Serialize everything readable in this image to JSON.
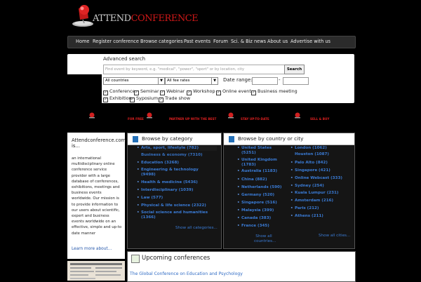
{
  "logo": {
    "part1": "ATTEND",
    "part2": "CONFERENCE"
  },
  "nav": [
    "Home",
    "Register conference",
    "Browse categories",
    "Past events",
    "Forum",
    "Sci. & Biz news",
    "About us",
    "Advertise with us"
  ],
  "search": {
    "title": "Advanced search",
    "placeholder": "Find event by keyword, e.g. \"medical\", \"power\", \"sport\" or by location, city",
    "button": "Search",
    "country_select": "All countries",
    "fee_select": "All fee rates",
    "date_label": "Date range:",
    "date_dash": "-",
    "types": [
      "Conference",
      "Seminar",
      "Webinar",
      "Workshop",
      "Online event",
      "Business meeting",
      "Exhibition",
      "Syposium",
      "Trade show"
    ]
  },
  "banner": [
    "FOR FREE",
    "PARTNER UP WITH THE BEST",
    "STAY UP-TO-DATE",
    "SELL & BUY"
  ],
  "about": {
    "title": "Attendconference.com is...",
    "body": "an international multidisciplinary online conference service provider with a large database of conferences, exhibitions, meetings and business events worldwide. Our mission is to provide information to our users about scientific, expert and business events worldwide on an effective, simple and up-to date manner",
    "more": "Learn more about..."
  },
  "categories": {
    "title": "Browse by category",
    "items": [
      "Arts, sport, lifestyle (782)",
      "Business & economy (7310)",
      "Education (3268)",
      "Engineering & technology (9498)",
      "Health & medicine (5436)",
      "Interdisciplinary (1039)",
      "Law (577)",
      "Physical & life science (2322)",
      "Social science and humanities (1366)"
    ],
    "show_all": "Show all categories..."
  },
  "countries": {
    "title": "Browse by country or city",
    "col1": [
      "United States (5251)",
      "United Kingdom (1783)",
      "Australia (1183)",
      "China (882)",
      "Netherlands (590)",
      "Germany (520)",
      "Singapore (516)",
      "Malaysia (399)",
      "Canada (383)",
      "France (345)"
    ],
    "col2": [
      "London (1062)",
      "Houston (1087)",
      "Palo Alto (842)",
      "Singapore (421)",
      "Online Webcast (333)",
      "Sydney (254)",
      "Kuala Lumpur (231)",
      "Amsterdam (216)",
      "Paris (212)",
      "Athens (211)"
    ],
    "show_all_countries": "Show all countries...",
    "show_all_cities": "Show all cities..."
  },
  "upcoming": {
    "title": "Upcoming conferences",
    "first_item": "The Global Conference on Education and Psychology"
  },
  "colors": {
    "accent_red": "#d01818",
    "link_blue": "#3a7bd5"
  }
}
